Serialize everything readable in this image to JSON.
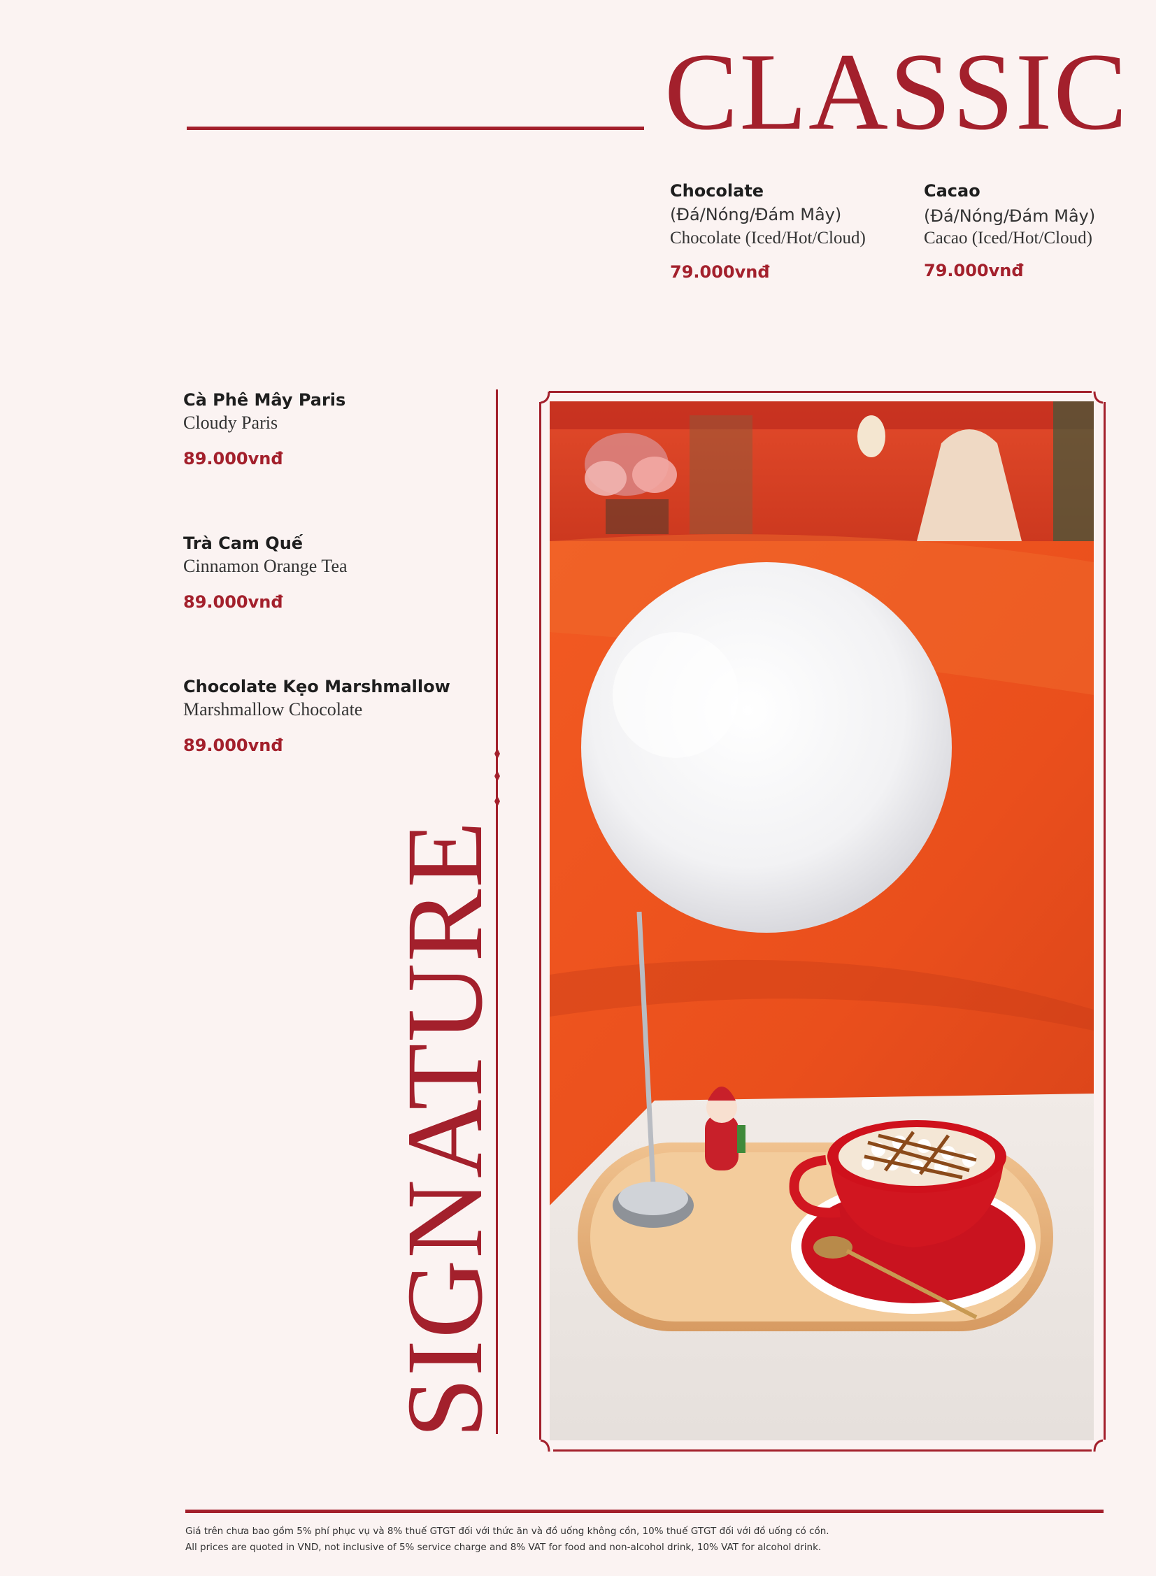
{
  "classic": {
    "title": "CLASSIC",
    "items": [
      {
        "name": "Chocolate",
        "vn": "(Đá/Nóng/Đám Mây)",
        "en": "Chocolate (Iced/Hot/Cloud)",
        "price": "79.000vnđ"
      },
      {
        "name": "Cacao",
        "vn": "(Đá/Nóng/Đám Mây)",
        "en": "Cacao (Iced/Hot/Cloud)",
        "price": "79.000vnđ"
      }
    ]
  },
  "signature": {
    "title": "SIGNATURE",
    "items": [
      {
        "name": "Cà Phê Mây Paris",
        "en": "Cloudy Paris",
        "price": "89.000vnđ"
      },
      {
        "name": "Trà Cam Quế",
        "en": "Cinnamon Orange Tea",
        "price": "89.000vnđ"
      },
      {
        "name": "Chocolate Kẹo Marshmallow",
        "en": "Marshmallow Chocolate",
        "price": "89.000vnđ"
      }
    ]
  },
  "footer": {
    "note_vn": "Giá trên chưa bao gồm 5% phí phục vụ và 8% thuế GTGT đối với thức ăn và đồ uống không cồn, 10% thuế GTGT đối với đồ uống có cồn.",
    "note_en": "All prices are quoted in VND, not inclusive of 5% service charge and 8% VAT for food and non-alcohol drink, 10% VAT for alcohol drink."
  },
  "colors": {
    "accent": "#a3202c",
    "background": "#fbf3f2"
  }
}
